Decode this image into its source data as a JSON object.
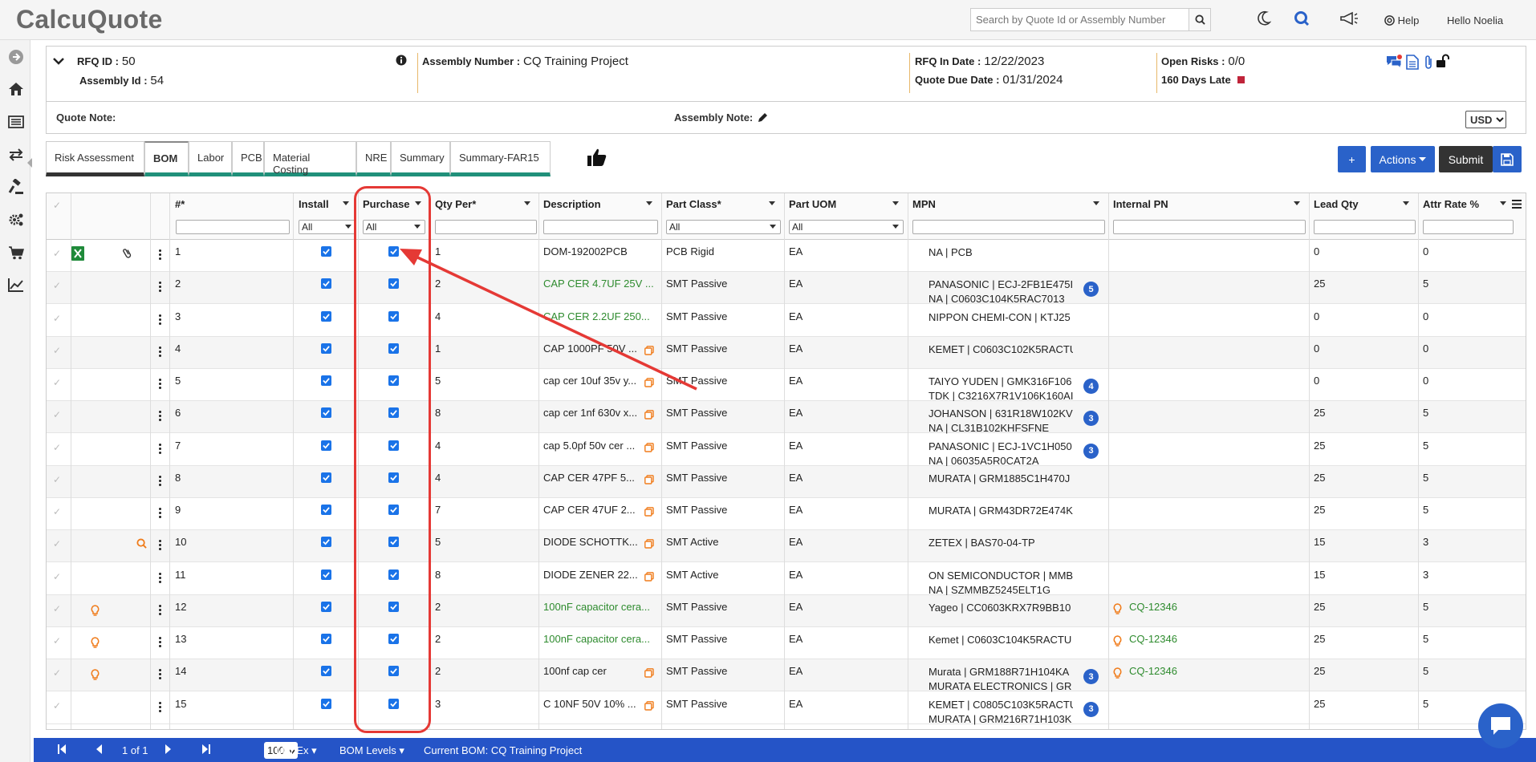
{
  "app": {
    "logo": "CalcuQuote"
  },
  "topbar": {
    "search_placeholder": "Search by Quote Id or Assembly Number",
    "help_label": "Help",
    "greeting": "Hello Noelia"
  },
  "header": {
    "rfq_id_label": "RFQ ID :",
    "rfq_id": "50",
    "assembly_id_label": "Assembly Id :",
    "assembly_id": "54",
    "assembly_number_label": "Assembly Number :",
    "assembly_number": "CQ Training Project",
    "rfq_in_date_label": "RFQ In Date :",
    "rfq_in_date": "12/22/2023",
    "quote_due_date_label": "Quote Due Date :",
    "quote_due_date": "01/31/2024",
    "open_risks_label": "Open Risks :",
    "open_risks": "0/0",
    "late_label": "160 Days Late",
    "quote_note_label": "Quote Note:",
    "assembly_note_label": "Assembly Note:",
    "currency": "USD"
  },
  "tabs": [
    "Risk Assessment",
    "BOM",
    "Labor",
    "PCB",
    "Material Costing",
    "NRE",
    "Summary",
    "Summary-FAR15"
  ],
  "actions": {
    "add_label": "+",
    "actions_label": "Actions",
    "submit_label": "Submit"
  },
  "grid": {
    "columns": {
      "num": "#*",
      "install": "Install",
      "purchase": "Purchase",
      "qty": "Qty Per*",
      "desc": "Description",
      "partclass": "Part Class*",
      "uom": "Part UOM",
      "mpn": "MPN",
      "ipn": "Internal PN",
      "leadqty": "Lead Qty",
      "attr": "Attr Rate %"
    },
    "filter_all": "All",
    "rows": [
      {
        "num": "1",
        "qty": "1",
        "desc": "DOM-192002PCB",
        "desc_green": false,
        "copy": false,
        "pclass": "PCB Rigid",
        "uom": "EA",
        "mpn1": "NA | PCB",
        "mpn2": "",
        "badge": "",
        "ipn": "",
        "lead": "0",
        "attr": "0",
        "icon": "excel"
      },
      {
        "num": "2",
        "qty": "2",
        "desc": "CAP CER 4.7UF 25V ...",
        "desc_green": true,
        "copy": false,
        "pclass": "SMT Passive",
        "uom": "EA",
        "mpn1": "PANASONIC | ECJ-2FB1E475I",
        "mpn2": "NA | C0603C104K5RAC7013",
        "badge": "5",
        "ipn": "",
        "lead": "25",
        "attr": "5",
        "icon": ""
      },
      {
        "num": "3",
        "qty": "4",
        "desc": "CAP CER 2.2UF 250...",
        "desc_green": true,
        "copy": false,
        "pclass": "SMT Passive",
        "uom": "EA",
        "mpn1": "NIPPON CHEMI-CON | KTJ25",
        "mpn2": "",
        "badge": "",
        "ipn": "",
        "lead": "0",
        "attr": "0",
        "icon": ""
      },
      {
        "num": "4",
        "qty": "1",
        "desc": "CAP 1000PF 50V ...",
        "desc_green": false,
        "copy": true,
        "pclass": "SMT Passive",
        "uom": "EA",
        "mpn1": "KEMET | C0603C102K5RACTU",
        "mpn2": "",
        "badge": "",
        "ipn": "",
        "lead": "0",
        "attr": "0",
        "icon": ""
      },
      {
        "num": "5",
        "qty": "5",
        "desc": "cap cer 10uf 35v y...",
        "desc_green": false,
        "copy": true,
        "pclass": "SMT Passive",
        "uom": "EA",
        "mpn1": "TAIYO YUDEN | GMK316F106",
        "mpn2": "TDK | C3216X7R1V106K160AI",
        "badge": "4",
        "ipn": "",
        "lead": "0",
        "attr": "0",
        "icon": ""
      },
      {
        "num": "6",
        "qty": "8",
        "desc": "cap cer 1nf 630v x...",
        "desc_green": false,
        "copy": true,
        "pclass": "SMT Passive",
        "uom": "EA",
        "mpn1": "JOHANSON | 631R18W102KV",
        "mpn2": "NA | CL31B102KHFSFNE",
        "badge": "3",
        "ipn": "",
        "lead": "25",
        "attr": "5",
        "icon": ""
      },
      {
        "num": "7",
        "qty": "4",
        "desc": "cap 5.0pf 50v cer ...",
        "desc_green": false,
        "copy": true,
        "pclass": "SMT Passive",
        "uom": "EA",
        "mpn1": "PANASONIC | ECJ-1VC1H050",
        "mpn2": "NA | 06035A5R0CAT2A",
        "badge": "3",
        "ipn": "",
        "lead": "25",
        "attr": "5",
        "icon": ""
      },
      {
        "num": "8",
        "qty": "4",
        "desc": "CAP CER 47PF 5...",
        "desc_green": false,
        "copy": true,
        "pclass": "SMT Passive",
        "uom": "EA",
        "mpn1": "MURATA | GRM1885C1H470J",
        "mpn2": "",
        "badge": "",
        "ipn": "",
        "lead": "25",
        "attr": "5",
        "icon": ""
      },
      {
        "num": "9",
        "qty": "7",
        "desc": "CAP CER 47UF 2...",
        "desc_green": false,
        "copy": true,
        "pclass": "SMT Passive",
        "uom": "EA",
        "mpn1": "MURATA | GRM43DR72E474K",
        "mpn2": "",
        "badge": "",
        "ipn": "",
        "lead": "25",
        "attr": "5",
        "icon": ""
      },
      {
        "num": "10",
        "qty": "5",
        "desc": "DIODE SCHOTTK...",
        "desc_green": false,
        "copy": true,
        "pclass": "SMT Active",
        "uom": "EA",
        "mpn1": "ZETEX | BAS70-04-TP",
        "mpn2": "",
        "badge": "",
        "ipn": "",
        "lead": "15",
        "attr": "3",
        "icon": "search"
      },
      {
        "num": "11",
        "qty": "8",
        "desc": "DIODE ZENER 22...",
        "desc_green": false,
        "copy": true,
        "pclass": "SMT Active",
        "uom": "EA",
        "mpn1": "ON SEMICONDUCTOR | MMB",
        "mpn2": "NA | SZMMBZ5245ELT1G",
        "badge": "",
        "ipn": "",
        "lead": "15",
        "attr": "3",
        "icon": ""
      },
      {
        "num": "12",
        "qty": "2",
        "desc": "100nF capacitor cera...",
        "desc_green": true,
        "copy": false,
        "pclass": "SMT Passive",
        "uom": "EA",
        "mpn1": "Yageo | CC0603KRX7R9BB10",
        "mpn2": "",
        "badge": "",
        "ipn": "CQ-12346",
        "lead": "25",
        "attr": "5",
        "icon": "bulb"
      },
      {
        "num": "13",
        "qty": "2",
        "desc": "100nF capacitor cera...",
        "desc_green": true,
        "copy": false,
        "pclass": "SMT Passive",
        "uom": "EA",
        "mpn1": "Kemet | C0603C104K5RACTU",
        "mpn2": "",
        "badge": "",
        "ipn": "CQ-12346",
        "lead": "25",
        "attr": "5",
        "icon": "bulb"
      },
      {
        "num": "14",
        "qty": "2",
        "desc": "100nf cap cer",
        "desc_green": false,
        "copy": true,
        "pclass": "SMT Passive",
        "uom": "EA",
        "mpn1": "Murata | GRM188R71H104KA",
        "mpn2": "MURATA ELECTRONICS | GR",
        "badge": "3",
        "ipn": "CQ-12346",
        "lead": "25",
        "attr": "5",
        "icon": "bulb"
      },
      {
        "num": "15",
        "qty": "3",
        "desc": "C 10NF 50V 10% ...",
        "desc_green": false,
        "copy": true,
        "pclass": "SMT Passive",
        "uom": "EA",
        "mpn1": "KEMET | C0805C103K5RACTU",
        "mpn2": "MURATA | GRM216R71H103K",
        "badge": "3",
        "ipn": "",
        "lead": "25",
        "attr": "5",
        "icon": ""
      }
    ]
  },
  "footer": {
    "page_info": "1 of 1",
    "page_size": "100",
    "manex": "ManEx",
    "bom_levels": "BOM Levels",
    "current_bom_label": "Current BOM:",
    "current_bom": "CQ Training Project"
  },
  "colors": {
    "accent": "#2a62c9",
    "tab_underline": "#20907a",
    "highlight": "#e53935",
    "green_text": "#2e8b2e"
  }
}
